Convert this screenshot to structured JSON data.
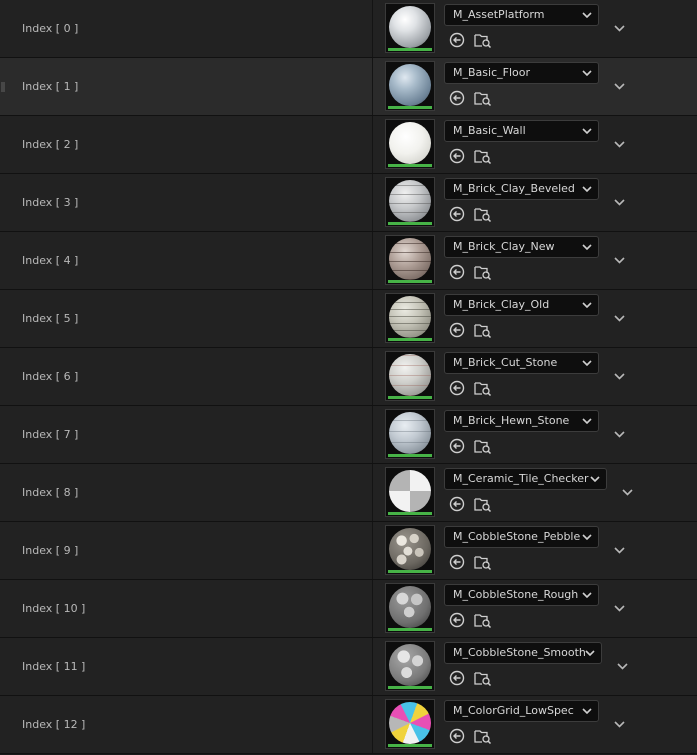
{
  "rows": [
    {
      "index_label": "Index [ 0 ]",
      "material": "M_AssetPlatform"
    },
    {
      "index_label": "Index [ 1 ]",
      "material": "M_Basic_Floor"
    },
    {
      "index_label": "Index [ 2 ]",
      "material": "M_Basic_Wall"
    },
    {
      "index_label": "Index [ 3 ]",
      "material": "M_Brick_Clay_Beveled"
    },
    {
      "index_label": "Index [ 4 ]",
      "material": "M_Brick_Clay_New"
    },
    {
      "index_label": "Index [ 5 ]",
      "material": "M_Brick_Clay_Old"
    },
    {
      "index_label": "Index [ 6 ]",
      "material": "M_Brick_Cut_Stone"
    },
    {
      "index_label": "Index [ 7 ]",
      "material": "M_Brick_Hewn_Stone"
    },
    {
      "index_label": "Index [ 8 ]",
      "material": "M_Ceramic_Tile_Checker"
    },
    {
      "index_label": "Index [ 9 ]",
      "material": "M_CobbleStone_Pebble"
    },
    {
      "index_label": "Index [ 10 ]",
      "material": "M_CobbleStone_Rough"
    },
    {
      "index_label": "Index [ 11 ]",
      "material": "M_CobbleStone_Smooth"
    },
    {
      "index_label": "Index [ 12 ]",
      "material": "M_ColorGrid_LowSpec"
    }
  ],
  "icons": {
    "thumbnail": "material-sphere-thumbnail",
    "combo_caret": "chevron-down-icon",
    "use_selected": "arrow-left-circle-icon",
    "browse": "folder-search-icon",
    "expand": "chevron-down-icon"
  },
  "colors": {
    "background": "#1a1a1a",
    "row": "#222222",
    "row_hovered": "#2b2b2b",
    "thumbnail_bar": "#47b347",
    "text": "#c0c0c0"
  }
}
